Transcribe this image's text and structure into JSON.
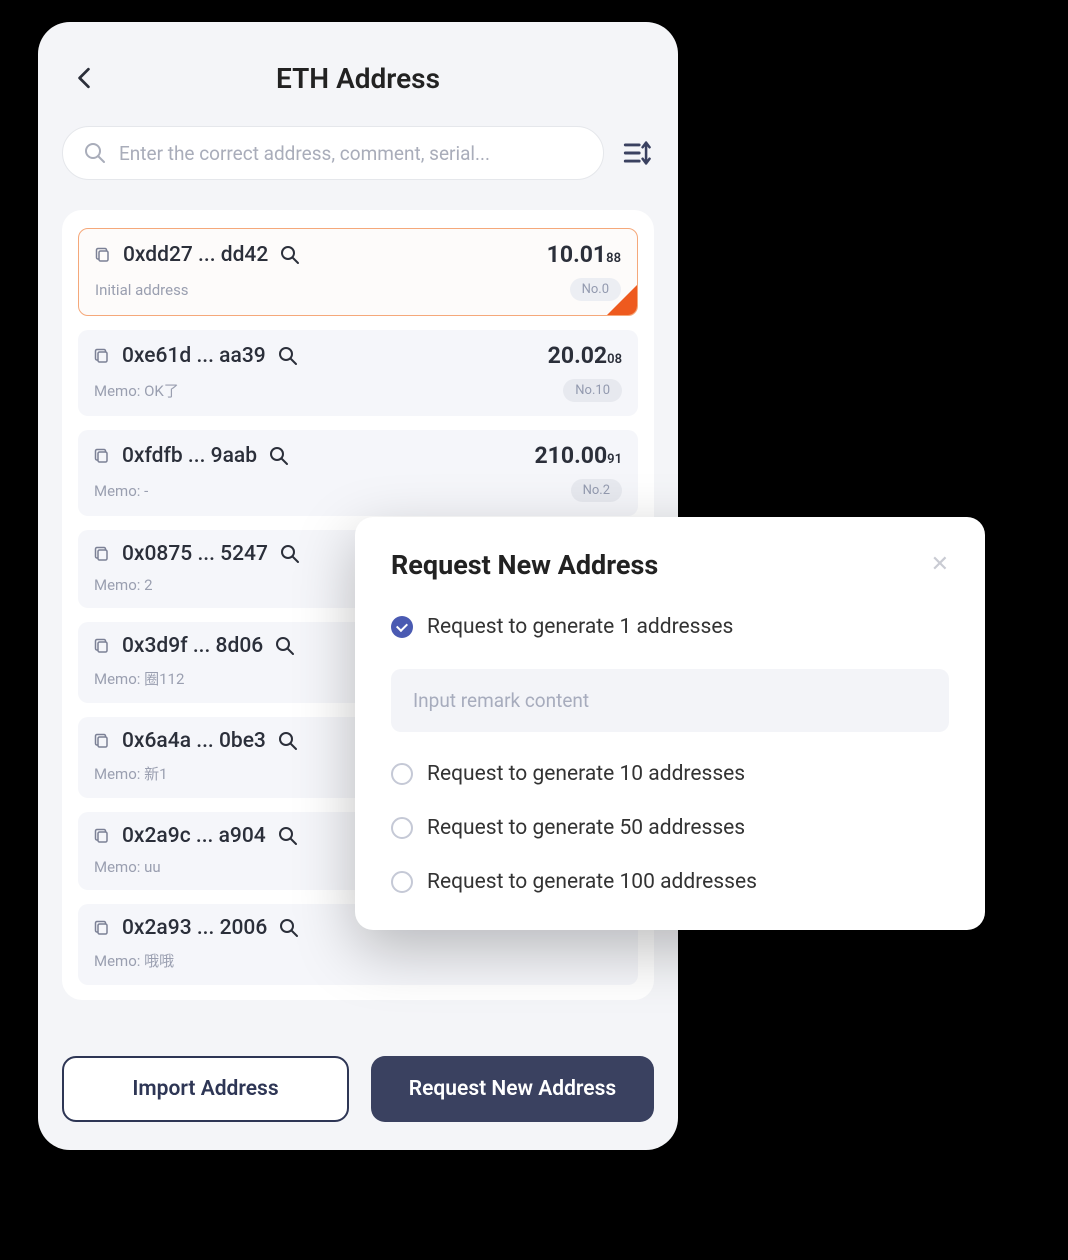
{
  "header": {
    "title": "ETH Address"
  },
  "search": {
    "placeholder": "Enter the correct address, comment, serial..."
  },
  "addresses": [
    {
      "addr": "0xdd27 ... dd42",
      "balance": "10.01",
      "balance_dec": "88",
      "memo": "Initial address",
      "badge": "No.0",
      "active": true
    },
    {
      "addr": "0xe61d ... aa39",
      "balance": "20.02",
      "balance_dec": "08",
      "memo": "Memo: OK了",
      "badge": "No.10",
      "active": false
    },
    {
      "addr": "0xfdfb ... 9aab",
      "balance": "210.00",
      "balance_dec": "91",
      "memo": "Memo: -",
      "badge": "No.2",
      "active": false
    },
    {
      "addr": "0x0875 ... 5247",
      "balance": "",
      "balance_dec": "",
      "memo": "Memo: 2",
      "badge": "",
      "active": false
    },
    {
      "addr": "0x3d9f ... 8d06",
      "balance": "",
      "balance_dec": "",
      "memo": "Memo: 圈112",
      "badge": "",
      "active": false
    },
    {
      "addr": "0x6a4a ... 0be3",
      "balance": "",
      "balance_dec": "",
      "memo": "Memo: 新1",
      "badge": "",
      "active": false
    },
    {
      "addr": "0x2a9c ... a904",
      "balance": "",
      "balance_dec": "",
      "memo": "Memo: uu",
      "badge": "",
      "active": false
    },
    {
      "addr": "0x2a93 ... 2006",
      "balance": "",
      "balance_dec": "",
      "memo": "Memo: 哦哦",
      "badge": "",
      "active": false
    }
  ],
  "footer": {
    "import_label": "Import Address",
    "request_label": "Request New Address"
  },
  "modal": {
    "title": "Request New Address",
    "remark_placeholder": "Input remark content",
    "options": [
      {
        "label": "Request to generate 1 addresses",
        "checked": true
      },
      {
        "label": "Request to generate 10 addresses",
        "checked": false
      },
      {
        "label": "Request to generate 50 addresses",
        "checked": false
      },
      {
        "label": "Request to generate 100 addresses",
        "checked": false
      }
    ]
  }
}
